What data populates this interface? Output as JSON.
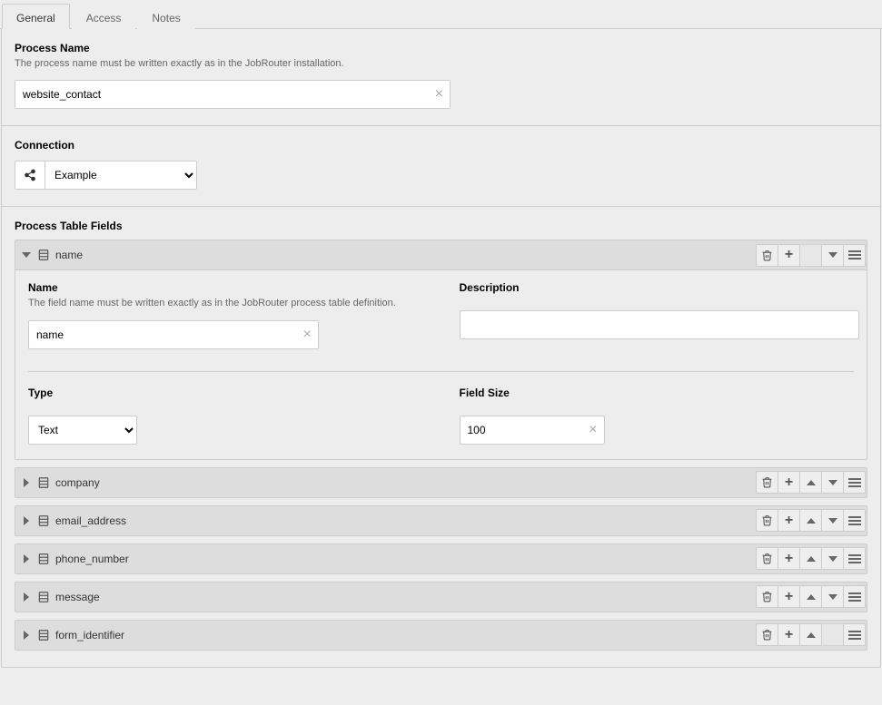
{
  "tabs": {
    "general": "General",
    "access": "Access",
    "notes": "Notes"
  },
  "process": {
    "title": "Process Name",
    "hint": "The process name must be written exactly as in the JobRouter installation.",
    "value": "website_contact"
  },
  "connection": {
    "title": "Connection",
    "value": "Example"
  },
  "fields": {
    "title": "Process Table Fields",
    "items": [
      {
        "name": "name",
        "expanded": true
      },
      {
        "name": "company",
        "expanded": false
      },
      {
        "name": "email_address",
        "expanded": false
      },
      {
        "name": "phone_number",
        "expanded": false
      },
      {
        "name": "message",
        "expanded": false
      },
      {
        "name": "form_identifier",
        "expanded": false
      }
    ],
    "detail": {
      "name_label": "Name",
      "name_hint": "The field name must be written exactly as in the JobRouter process table definition.",
      "name_value": "name",
      "desc_label": "Description",
      "desc_value": "",
      "type_label": "Type",
      "type_value": "Text",
      "size_label": "Field Size",
      "size_value": "100"
    }
  }
}
